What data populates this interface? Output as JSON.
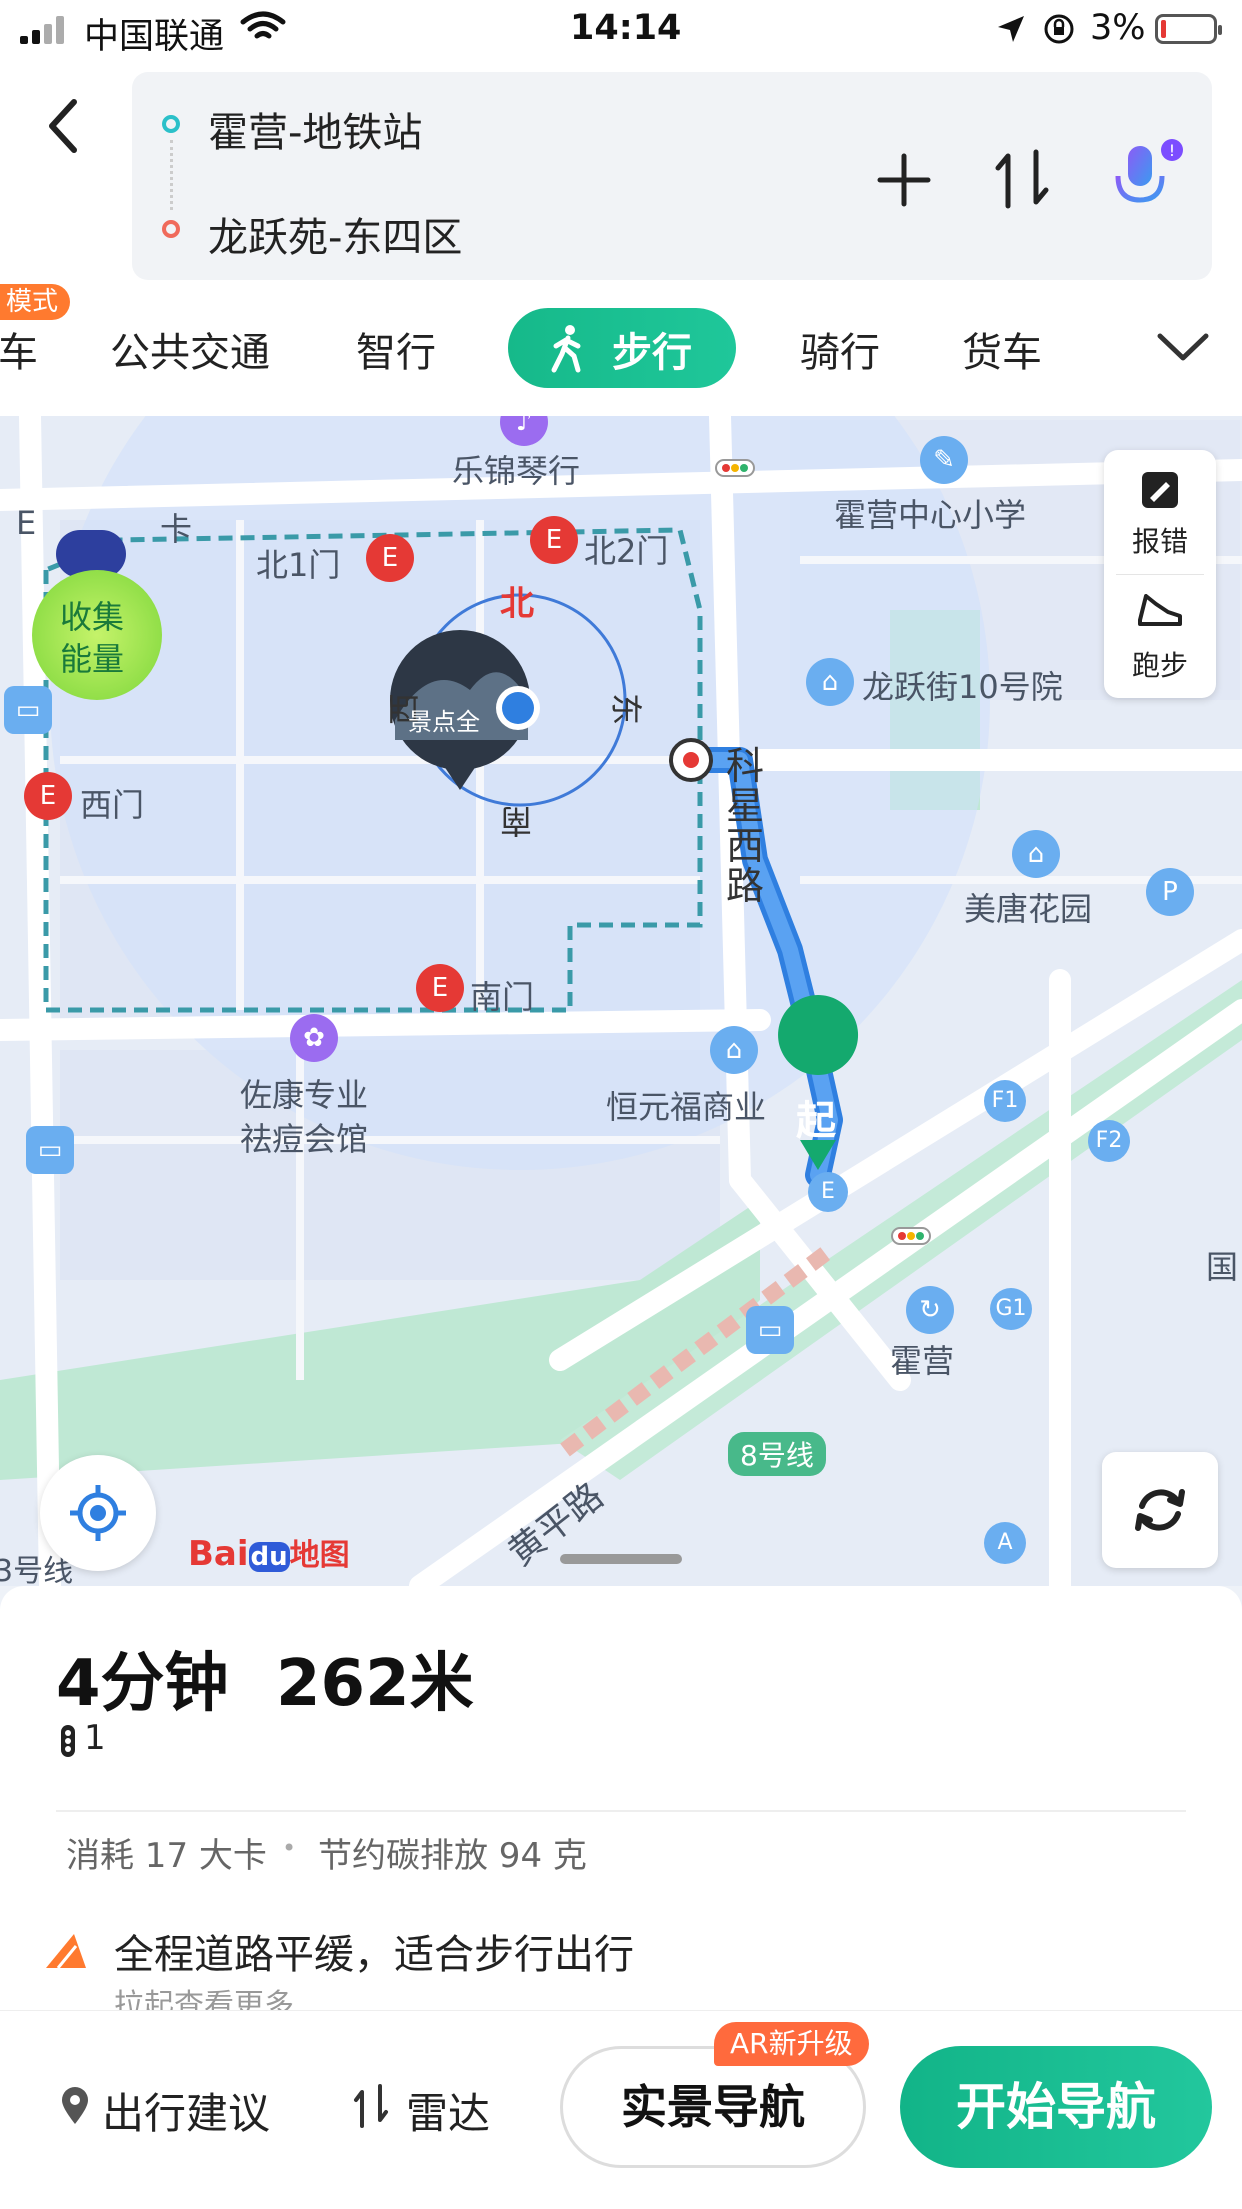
{
  "status_bar": {
    "carrier": "中国联通",
    "time": "14:14",
    "battery": "3%"
  },
  "header": {
    "start": "霍营-地铁站",
    "end": "龙跃苑-东四区"
  },
  "tabs": {
    "mode_badge": "模式",
    "items": [
      {
        "label": "车"
      },
      {
        "label": "公共交通"
      },
      {
        "label": "智行"
      },
      {
        "label": "步行",
        "active": true
      },
      {
        "label": "骑行"
      },
      {
        "label": "货车"
      }
    ]
  },
  "map": {
    "labels": {
      "lejin": "乐锦琴行",
      "huoying_school": "霍营中心小学",
      "north1": "北1门",
      "north2": "北2门",
      "north": "北",
      "east": "东",
      "south": "南",
      "west": "西",
      "photo_caption": "景点全",
      "longyue10": "龙跃街10号院",
      "west_gate": "西门",
      "meitang": "美唐花园",
      "keixing_road": "科星西路",
      "south_gate": "南门",
      "zuokang_1": "佐康专业",
      "zuokang_2": "祛痘会馆",
      "hengyuanfu": "恒元福商业",
      "start_marker": "起",
      "huoying_station": "霍营",
      "line8": "8号线",
      "huangping": "黄平路",
      "line13_partial": "3号线",
      "guo": "国",
      "collect_1": "收集",
      "collect_2": "能量",
      "exit_e": "E",
      "exit_f1": "F1",
      "exit_f2": "F2",
      "exit_g1": "G1",
      "exit_a": "A",
      "partial_e": "E",
      "partial_ka": "卡"
    },
    "side_panel": {
      "report": "报错",
      "run": "跑步"
    },
    "brand": {
      "bai": "Bai",
      "du": "du",
      "map": "地图"
    }
  },
  "summary": {
    "duration": "4分钟",
    "distance": "262米",
    "traffic_lights": "1",
    "calories": "消耗 17 大卡",
    "separator": "•",
    "carbon": "节约碳排放 94 克",
    "tip": "全程道路平缓，适合步行出行",
    "more": "拉起查看更多"
  },
  "bottom_bar": {
    "advice": "出行建议",
    "radar": "雷达",
    "ar_nav": "实景导航",
    "ar_badge": "AR新升级",
    "start_nav": "开始导航"
  },
  "colors": {
    "accent": "#16b98a",
    "route": "#3b82f6",
    "poi_red": "#e53935",
    "badge_orange": "#ff7a2f"
  }
}
